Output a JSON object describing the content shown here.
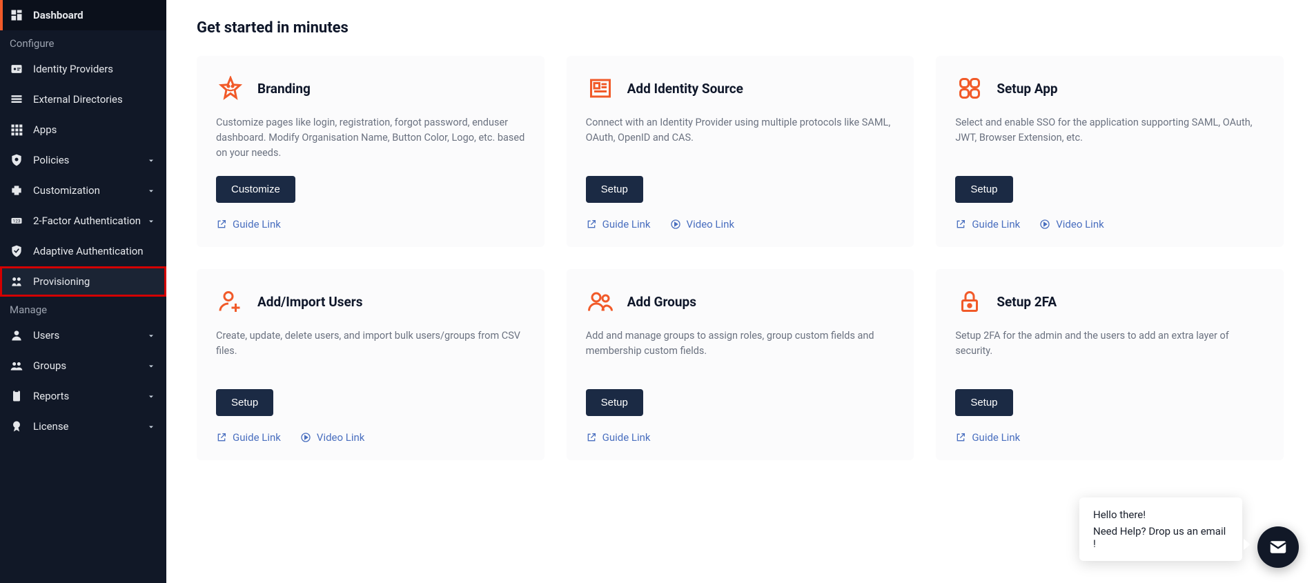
{
  "accent": "#f15a29",
  "sidebar": {
    "items": [
      {
        "label": "Dashboard",
        "icon": "dashboard-icon",
        "active": true
      },
      {
        "section": "Configure"
      },
      {
        "label": "Identity Providers",
        "icon": "id-icon"
      },
      {
        "label": "External Directories",
        "icon": "list-icon"
      },
      {
        "label": "Apps",
        "icon": "apps-icon"
      },
      {
        "label": "Policies",
        "icon": "shield-gear-icon",
        "expandable": true
      },
      {
        "label": "Customization",
        "icon": "puzzle-icon",
        "expandable": true
      },
      {
        "label": "2-Factor Authentication",
        "icon": "twofa-icon",
        "expandable": true
      },
      {
        "label": "Adaptive Authentication",
        "icon": "shield-check-icon"
      },
      {
        "label": "Provisioning",
        "icon": "users-sync-icon",
        "highlighted": true
      },
      {
        "section": "Manage"
      },
      {
        "label": "Users",
        "icon": "user-icon",
        "expandable": true
      },
      {
        "label": "Groups",
        "icon": "groups-icon",
        "expandable": true
      },
      {
        "label": "Reports",
        "icon": "clipboard-icon",
        "expandable": true
      },
      {
        "label": "License",
        "icon": "license-icon",
        "expandable": true
      }
    ]
  },
  "main": {
    "title": "Get started in minutes",
    "cards": [
      {
        "icon": "star-icon",
        "title": "Branding",
        "desc": "Customize pages like login, registration, forgot password, enduser dashboard. Modify Organisation Name, Button Color, Logo, etc. based on your needs.",
        "button": "Customize",
        "links": [
          {
            "label": "Guide Link",
            "kind": "guide"
          }
        ]
      },
      {
        "icon": "news-icon",
        "title": "Add Identity Source",
        "desc": "Connect with an Identity Provider using multiple protocols like SAML, OAuth, OpenID and CAS.",
        "button": "Setup",
        "links": [
          {
            "label": "Guide Link",
            "kind": "guide"
          },
          {
            "label": "Video Link",
            "kind": "video"
          }
        ]
      },
      {
        "icon": "grid4-icon",
        "title": "Setup App",
        "desc": "Select and enable SSO for the application supporting SAML, OAuth, JWT, Browser Extension, etc.",
        "button": "Setup",
        "links": [
          {
            "label": "Guide Link",
            "kind": "guide"
          },
          {
            "label": "Video Link",
            "kind": "video"
          }
        ]
      },
      {
        "icon": "user-plus-icon",
        "title": "Add/Import Users",
        "desc": "Create, update, delete users, and import bulk users/groups from CSV files.",
        "button": "Setup",
        "links": [
          {
            "label": "Guide Link",
            "kind": "guide"
          },
          {
            "label": "Video Link",
            "kind": "video"
          }
        ]
      },
      {
        "icon": "two-users-icon",
        "title": "Add Groups",
        "desc": "Add and manage groups to assign roles, group custom fields and membership custom fields.",
        "button": "Setup",
        "links": [
          {
            "label": "Guide Link",
            "kind": "guide"
          }
        ]
      },
      {
        "icon": "lock-icon",
        "title": "Setup 2FA",
        "desc": "Setup 2FA for the admin and the users to add an extra layer of security.",
        "button": "Setup",
        "links": [
          {
            "label": "Guide Link",
            "kind": "guide"
          }
        ]
      }
    ]
  },
  "chat": {
    "line1": "Hello there!",
    "line2": "Need Help? Drop us an email !"
  }
}
